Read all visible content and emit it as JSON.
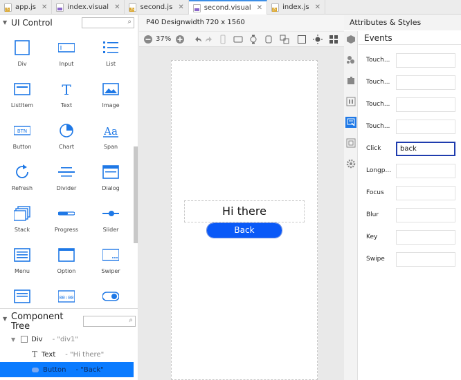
{
  "tabs": [
    {
      "label": "app.js",
      "type": "js",
      "active": false
    },
    {
      "label": "index.visual",
      "type": "visual",
      "active": false
    },
    {
      "label": "second.js",
      "type": "js",
      "active": false
    },
    {
      "label": "second.visual",
      "type": "visual",
      "active": true
    },
    {
      "label": "index.js",
      "type": "js",
      "active": false
    }
  ],
  "left": {
    "title": "UI Control",
    "controls": [
      {
        "label": "Div",
        "icon": "div-icon"
      },
      {
        "label": "Input",
        "icon": "input-icon"
      },
      {
        "label": "List",
        "icon": "list-icon"
      },
      {
        "label": "ListItem",
        "icon": "listitem-icon"
      },
      {
        "label": "Text",
        "icon": "text-icon"
      },
      {
        "label": "Image",
        "icon": "image-icon"
      },
      {
        "label": "Button",
        "icon": "button-icon"
      },
      {
        "label": "Chart",
        "icon": "chart-icon"
      },
      {
        "label": "Span",
        "icon": "span-icon"
      },
      {
        "label": "Refresh",
        "icon": "refresh-icon"
      },
      {
        "label": "Divider",
        "icon": "divider-icon"
      },
      {
        "label": "Dialog",
        "icon": "dialog-icon"
      },
      {
        "label": "Stack",
        "icon": "stack-icon"
      },
      {
        "label": "Progress",
        "icon": "progress-icon"
      },
      {
        "label": "Slider",
        "icon": "slider-icon"
      },
      {
        "label": "Menu",
        "icon": "menu-icon"
      },
      {
        "label": "Option",
        "icon": "option-icon"
      },
      {
        "label": "Swiper",
        "icon": "swiper-icon"
      },
      {
        "label": "",
        "icon": "picker-icon"
      },
      {
        "label": "",
        "icon": "timer-icon"
      },
      {
        "label": "",
        "icon": "toggle-icon"
      }
    ],
    "tree_title": "Component Tree",
    "tree": [
      {
        "name": "Div",
        "id": "- \"div1\""
      },
      {
        "name": "Text",
        "id": "- \"Hi there\""
      },
      {
        "name": "Button",
        "id": "- \"Back\""
      }
    ]
  },
  "center": {
    "device": "P40 Designwidth",
    "resolution": "720 x 1560",
    "zoom": "37%",
    "canvas_text": "Hi there",
    "canvas_button": "Back"
  },
  "right": {
    "title": "Attributes & Styles",
    "section": "Events",
    "events": [
      {
        "label": "Touch...",
        "value": ""
      },
      {
        "label": "Touch...",
        "value": ""
      },
      {
        "label": "Touch...",
        "value": ""
      },
      {
        "label": "Touch...",
        "value": ""
      },
      {
        "label": "Click",
        "value": "back"
      },
      {
        "label": "Longp...",
        "value": ""
      },
      {
        "label": "Focus",
        "value": ""
      },
      {
        "label": "Blur",
        "value": ""
      },
      {
        "label": "Key",
        "value": ""
      },
      {
        "label": "Swipe",
        "value": ""
      }
    ]
  },
  "colors": {
    "accent": "#0a59f7",
    "selection": "#0a7bff",
    "icon": "#1e78e6"
  }
}
